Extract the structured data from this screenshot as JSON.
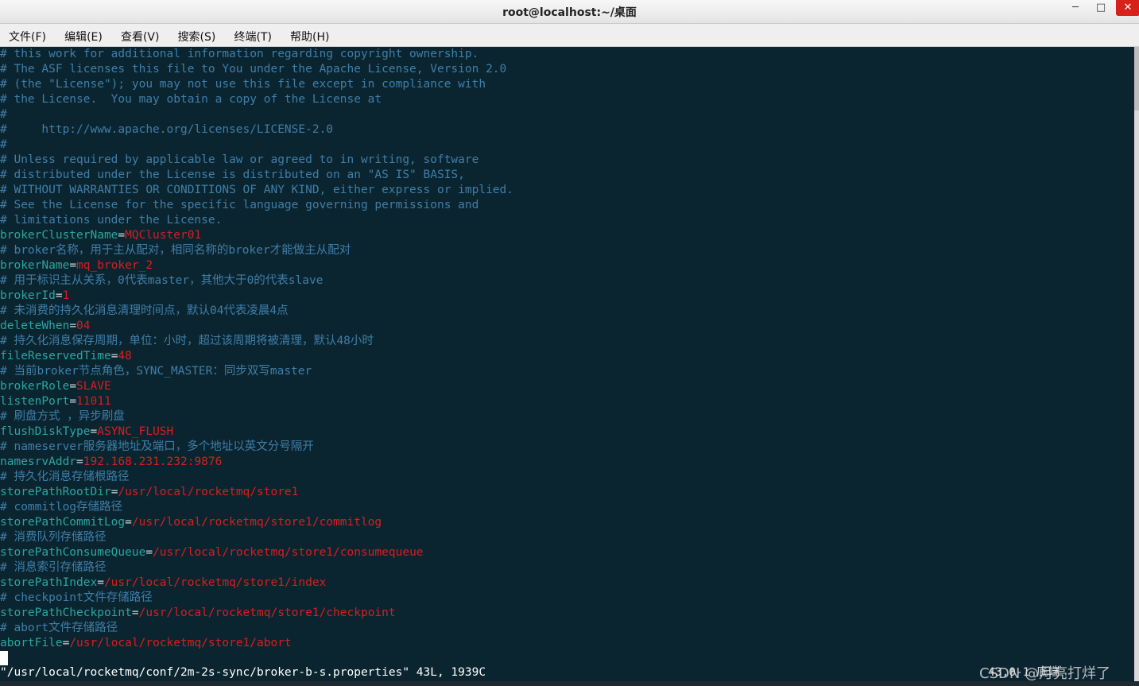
{
  "window": {
    "title": "root@localhost:~/桌面",
    "minimize_glyph": "─",
    "maximize_glyph": "□",
    "close_glyph": "✕"
  },
  "menu": [
    "文件(F)",
    "编辑(E)",
    "查看(V)",
    "搜索(S)",
    "终端(T)",
    "帮助(H)"
  ],
  "terminal": {
    "lines": [
      {
        "type": "comment",
        "text": "# this work for additional information regarding copyright ownership."
      },
      {
        "type": "comment",
        "text": "# The ASF licenses this file to You under the Apache License, Version 2.0"
      },
      {
        "type": "comment",
        "text": "# (the \"License\"); you may not use this file except in compliance with"
      },
      {
        "type": "comment",
        "text": "# the License.  You may obtain a copy of the License at"
      },
      {
        "type": "comment",
        "text": "#"
      },
      {
        "type": "comment",
        "text": "#     http://www.apache.org/licenses/LICENSE-2.0"
      },
      {
        "type": "comment",
        "text": "#"
      },
      {
        "type": "comment",
        "text": "# Unless required by applicable law or agreed to in writing, software"
      },
      {
        "type": "comment",
        "text": "# distributed under the License is distributed on an \"AS IS\" BASIS,"
      },
      {
        "type": "comment",
        "text": "# WITHOUT WARRANTIES OR CONDITIONS OF ANY KIND, either express or implied."
      },
      {
        "type": "comment",
        "text": "# See the License for the specific language governing permissions and"
      },
      {
        "type": "comment",
        "text": "# limitations under the License."
      },
      {
        "type": "kv",
        "key": "brokerClusterName",
        "value": "MQCluster01"
      },
      {
        "type": "comment",
        "text": "# broker名称，用于主从配对，相同名称的broker才能做主从配对"
      },
      {
        "type": "kv",
        "key": "brokerName",
        "value": "mq_broker_2"
      },
      {
        "type": "comment",
        "text": "# 用于标识主从关系，0代表master，其他大于0的代表slave"
      },
      {
        "type": "kv",
        "key": "brokerId",
        "value": "1"
      },
      {
        "type": "comment",
        "text": "# 未消费的持久化消息清理时间点，默认04代表凌晨4点"
      },
      {
        "type": "kv",
        "key": "deleteWhen",
        "value": "04"
      },
      {
        "type": "comment",
        "text": "# 持久化消息保存周期，单位：小时，超过该周期将被清理，默认48小时"
      },
      {
        "type": "kv",
        "key": "fileReservedTime",
        "value": "48"
      },
      {
        "type": "comment",
        "text": "# 当前broker节点角色，SYNC_MASTER：同步双写master"
      },
      {
        "type": "kv",
        "key": "brokerRole",
        "value": "SLAVE"
      },
      {
        "type": "kv",
        "key": "listenPort",
        "value": "11011"
      },
      {
        "type": "comment",
        "text": "# 刷盘方式 ，异步刷盘"
      },
      {
        "type": "kv",
        "key": "flushDiskType",
        "value": "ASYNC_FLUSH"
      },
      {
        "type": "comment",
        "text": "# nameserver服务器地址及端口，多个地址以英文分号隔开"
      },
      {
        "type": "kv",
        "key": "namesrvAddr",
        "value": "192.168.231.232:9876"
      },
      {
        "type": "comment",
        "text": "# 持久化消息存储根路径"
      },
      {
        "type": "kv",
        "key": "storePathRootDir",
        "value": "/usr/local/rocketmq/store1"
      },
      {
        "type": "comment",
        "text": "# commitlog存储路径"
      },
      {
        "type": "kv",
        "key": "storePathCommitLog",
        "value": "/usr/local/rocketmq/store1/commitlog"
      },
      {
        "type": "comment",
        "text": "# 消费队列存储路径"
      },
      {
        "type": "kv",
        "key": "storePathConsumeQueue",
        "value": "/usr/local/rocketmq/store1/consumequeue"
      },
      {
        "type": "comment",
        "text": "# 消息索引存储路径"
      },
      {
        "type": "kv",
        "key": "storePathIndex",
        "value": "/usr/local/rocketmq/store1/index"
      },
      {
        "type": "comment",
        "text": "# checkpoint文件存储路径"
      },
      {
        "type": "kv",
        "key": "storePathCheckpoint",
        "value": "/usr/local/rocketmq/store1/checkpoint"
      },
      {
        "type": "comment",
        "text": "# abort文件存储路径"
      },
      {
        "type": "kv",
        "key": "abortFile",
        "value": "/usr/local/rocketmq/store1/abort"
      },
      {
        "type": "cursor"
      }
    ],
    "status_line": "\"/usr/local/rocketmq/conf/2m-2s-sync/broker-b-s.properties\" 43L, 1939C",
    "cursor_position": "43,0-1",
    "scroll_indicator": "底端"
  },
  "watermark": "CSDN @月亮打烊了",
  "colors": {
    "background": "#0b2530",
    "comment": "#3f7ea9",
    "key": "#2aa5a0",
    "value": "#d71e1e"
  }
}
